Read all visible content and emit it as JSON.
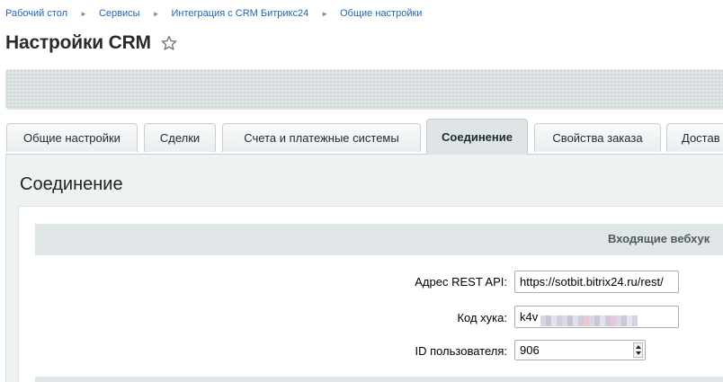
{
  "breadcrumb": {
    "items": [
      "Рабочий стол",
      "Сервисы",
      "Интеграция с CRM Битрикс24",
      "Общие настройки"
    ]
  },
  "page": {
    "title": "Настройки CRM",
    "favorite_icon": "star-icon"
  },
  "tabs": [
    {
      "label": "Общие настройки",
      "active": false
    },
    {
      "label": "Сделки",
      "active": false
    },
    {
      "label": "Счета и платежные системы",
      "active": false
    },
    {
      "label": "Соединение",
      "active": true
    },
    {
      "label": "Свойства заказа",
      "active": false
    },
    {
      "label": "Достав",
      "active": false
    }
  ],
  "section": {
    "title": "Соединение",
    "group_title": "Входящие вебхук",
    "fields": {
      "rest_api": {
        "label": "Адрес REST API:",
        "value": "https://sotbit.bitrix24.ru/rest/"
      },
      "hook_code": {
        "label": "Код хука:",
        "value_visible_prefix": "k4v"
      },
      "user_id": {
        "label": "ID пользователя:",
        "value": "906"
      }
    }
  },
  "colors": {
    "link": "#2067b0",
    "panel_bg": "#eff2f3",
    "header_bg": "#e0e6e8",
    "toolbar_bg": "#dfe4e5"
  }
}
